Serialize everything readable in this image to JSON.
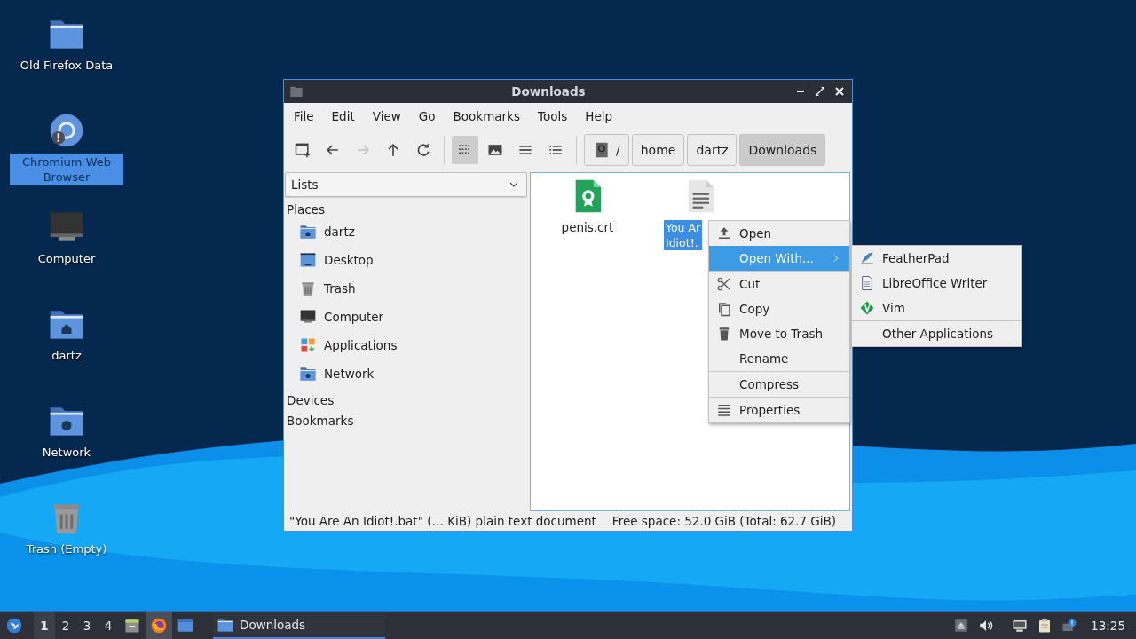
{
  "desktop_icons": [
    {
      "label": "Old Firefox Data",
      "kind": "folder",
      "selected": false
    },
    {
      "label": "Chromium Web Browser",
      "kind": "chromium",
      "selected": true
    },
    {
      "label": "Computer",
      "kind": "computer",
      "selected": false
    },
    {
      "label": "dartz",
      "kind": "home",
      "selected": false
    },
    {
      "label": "Network",
      "kind": "network",
      "selected": false
    },
    {
      "label": "Trash (Empty)",
      "kind": "trash",
      "selected": false
    }
  ],
  "window": {
    "title": "Downloads",
    "menu": [
      "File",
      "Edit",
      "View",
      "Go",
      "Bookmarks",
      "Tools",
      "Help"
    ],
    "toolbar": [
      {
        "kind": "new-tab",
        "disabled": false,
        "selected": false
      },
      {
        "kind": "back",
        "disabled": false,
        "selected": false
      },
      {
        "kind": "forward",
        "disabled": true,
        "selected": false
      },
      {
        "kind": "up",
        "disabled": false,
        "selected": false
      },
      {
        "kind": "reload",
        "disabled": false,
        "selected": false
      },
      {
        "kind": "icon-view",
        "disabled": false,
        "selected": true
      },
      {
        "kind": "thumbnail-view",
        "disabled": false,
        "selected": false
      },
      {
        "kind": "compact-view",
        "disabled": false,
        "selected": false
      },
      {
        "kind": "detail-view",
        "disabled": false,
        "selected": false
      }
    ],
    "path": [
      {
        "label": "/",
        "kind": "root",
        "selected": false
      },
      {
        "label": "home",
        "kind": "dir",
        "selected": false
      },
      {
        "label": "dartz",
        "kind": "dir",
        "selected": false
      },
      {
        "label": "Downloads",
        "kind": "dir",
        "selected": true
      }
    ],
    "side_pane": {
      "mode": "Lists",
      "sections": [
        {
          "title": "Places",
          "items": [
            {
              "label": "dartz",
              "kind": "home"
            },
            {
              "label": "Desktop",
              "kind": "desktop"
            },
            {
              "label": "Trash",
              "kind": "trash"
            },
            {
              "label": "Computer",
              "kind": "computer"
            },
            {
              "label": "Applications",
              "kind": "applications"
            },
            {
              "label": "Network",
              "kind": "network"
            }
          ]
        },
        {
          "title": "Devices"
        },
        {
          "title": "Bookmarks"
        }
      ]
    },
    "files": [
      {
        "label_lines": [
          "penis.crt"
        ],
        "kind": "certificate",
        "selected": false
      },
      {
        "label_lines": [
          "You Ar",
          "Idiot!."
        ],
        "kind": "text",
        "selected": true
      }
    ],
    "status_bar": {
      "selection": "\"You Are An Idiot!.bat\" (… KiB) plain text document",
      "free_space": "Free space: 52.0 GiB (Total: 62.7 GiB)"
    }
  },
  "context_menu": {
    "items": [
      {
        "label": "Open",
        "kind": "open",
        "highlighted": false,
        "separator_before": false,
        "submenu": false
      },
      {
        "label": "Open With...",
        "kind": "plain",
        "highlighted": true,
        "separator_before": false,
        "submenu": true
      },
      {
        "label": "Cut",
        "kind": "cut",
        "highlighted": false,
        "separator_before": true,
        "submenu": false
      },
      {
        "label": "Copy",
        "kind": "copy",
        "highlighted": false,
        "separator_before": false,
        "submenu": false
      },
      {
        "label": "Move to Trash",
        "kind": "trash",
        "highlighted": false,
        "separator_before": false,
        "submenu": false
      },
      {
        "label": "Rename",
        "kind": "plain",
        "highlighted": false,
        "separator_before": false,
        "submenu": false
      },
      {
        "label": "Compress",
        "kind": "plain",
        "highlighted": false,
        "separator_before": true,
        "submenu": false
      },
      {
        "label": "Properties",
        "kind": "properties",
        "highlighted": false,
        "separator_before": true,
        "submenu": false
      }
    ],
    "submenu": [
      {
        "label": "FeatherPad",
        "kind": "featherpad",
        "highlighted": false,
        "separator_before": false,
        "submenu": false
      },
      {
        "label": "LibreOffice Writer",
        "kind": "writer",
        "highlighted": false,
        "separator_before": false,
        "submenu": false
      },
      {
        "label": "Vim",
        "kind": "vim",
        "highlighted": false,
        "separator_before": false,
        "submenu": false
      },
      {
        "label": "Other Applications",
        "kind": "plain",
        "highlighted": false,
        "separator_before": true,
        "submenu": false
      }
    ]
  },
  "taskbar": {
    "workspaces": [
      {
        "label": "1",
        "selected": true
      },
      {
        "label": "2",
        "selected": false
      },
      {
        "label": "3",
        "selected": false
      },
      {
        "label": "4",
        "selected": false
      }
    ],
    "launchers": [
      {
        "kind": "files",
        "selected": false
      },
      {
        "kind": "firefox",
        "selected": true
      },
      {
        "kind": "desktop",
        "selected": false
      }
    ],
    "tasks": [
      {
        "label": "Downloads",
        "kind": "folder",
        "selected": true
      }
    ],
    "tray": [
      {
        "kind": "eject"
      },
      {
        "kind": "volume"
      },
      {
        "kind": "network"
      },
      {
        "kind": "clipboard"
      },
      {
        "kind": "notification"
      }
    ],
    "clock": "13:25"
  }
}
